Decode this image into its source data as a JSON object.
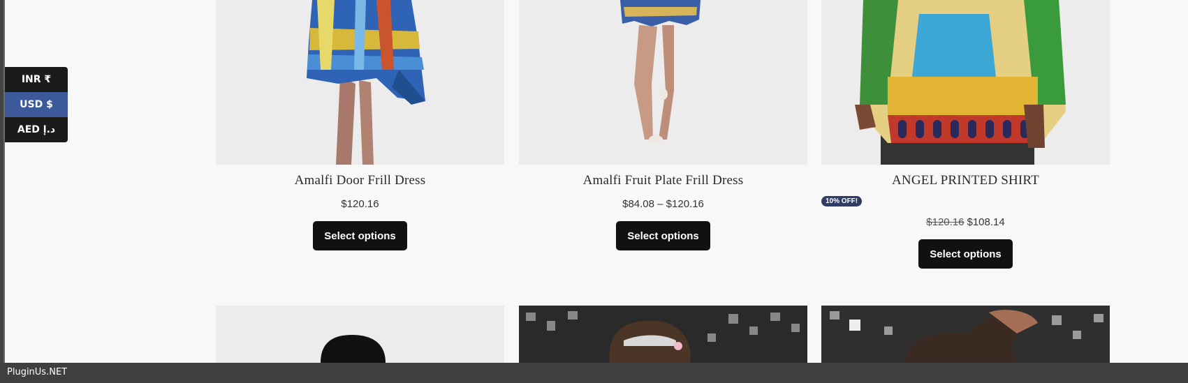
{
  "currency_switcher": {
    "items": [
      {
        "label": "INR ₹",
        "active": false
      },
      {
        "label": "USD $",
        "active": true
      },
      {
        "label": "AED د.إ",
        "active": false
      }
    ],
    "active_color": "#3c5a9a"
  },
  "products": [
    {
      "title": "Amalfi Door Frill Dress",
      "price": "$120.16",
      "button": "Select options"
    },
    {
      "title": "Amalfi Fruit Plate Frill Dress",
      "price": "$84.08 – $120.16",
      "button": "Select options"
    },
    {
      "title": "ANGEL PRINTED SHIRT",
      "badge": "10% OFF!",
      "price_old": "$120.16",
      "price": "$108.14",
      "button": "Select options"
    }
  ],
  "footer": {
    "brand": "PluginUs.NET"
  }
}
